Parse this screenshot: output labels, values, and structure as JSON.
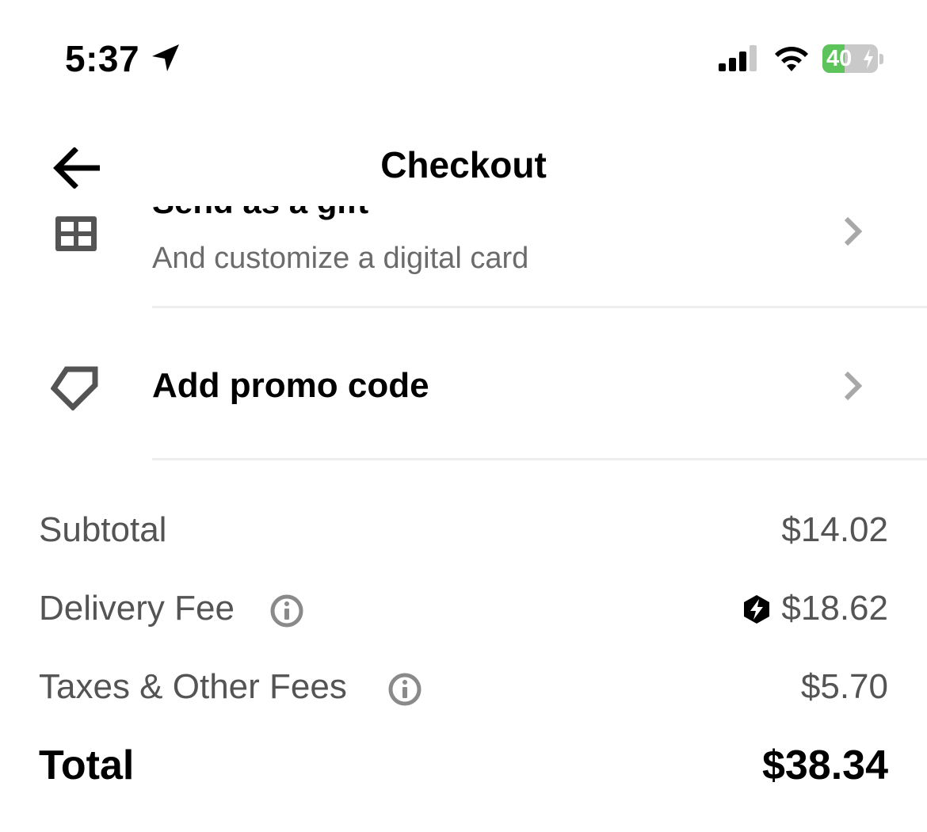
{
  "status_bar": {
    "time": "5:37",
    "battery_percent": "40",
    "battery_level": 0.4,
    "icons": [
      "location-arrow-icon",
      "cellular-signal-icon",
      "wifi-icon",
      "battery-charging-icon"
    ],
    "battery_fill_color": "#5cc45a"
  },
  "header": {
    "title": "Checkout",
    "back_icon": "arrow-left-icon"
  },
  "gift_row": {
    "title": "Send as a gift",
    "subtitle": "And customize a digital card",
    "icon": "gift-grid-icon",
    "chevron_icon": "chevron-right-icon"
  },
  "promo_row": {
    "label": "Add promo code",
    "icon": "tag-icon",
    "chevron_icon": "chevron-right-icon"
  },
  "summary": {
    "subtotal_label": "Subtotal",
    "subtotal_value": "$14.02",
    "delivery_label": "Delivery Fee",
    "delivery_value": "$18.62",
    "delivery_badge_icon": "uber-one-bolt-icon",
    "taxes_label": "Taxes & Other Fees",
    "taxes_value": "$5.70",
    "total_label": "Total",
    "total_value": "$38.34"
  },
  "colors": {
    "text_primary": "#000000",
    "text_secondary": "#545454",
    "divider": "#eeeeee",
    "icon_gray": "#545454"
  }
}
